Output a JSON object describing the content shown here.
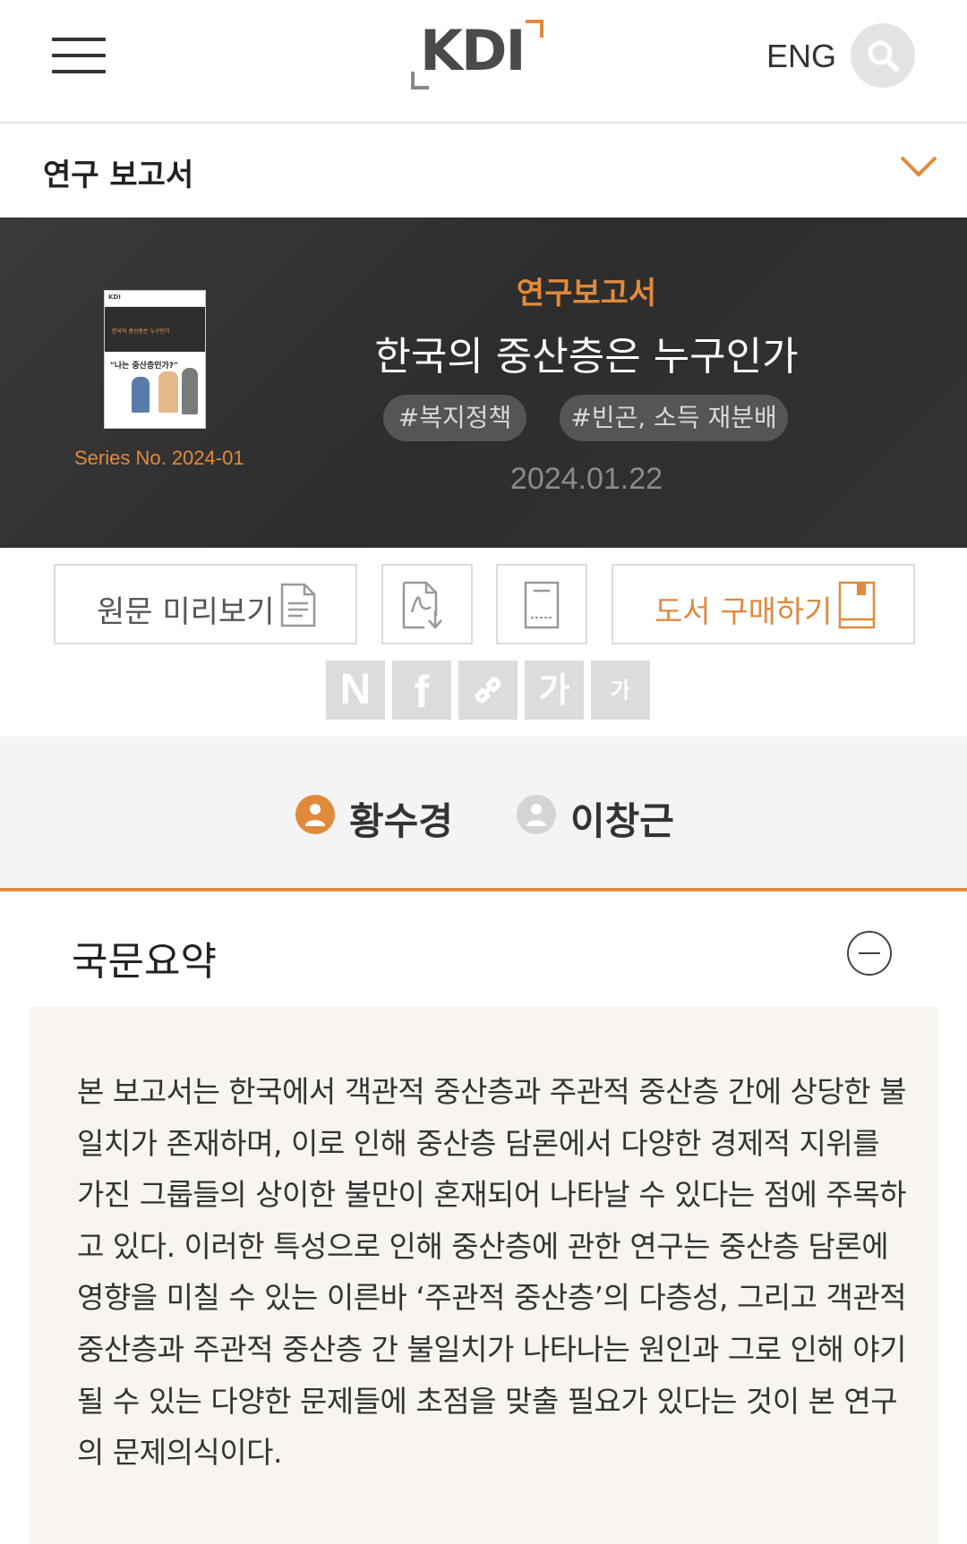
{
  "header": {
    "logo_text": "KDI",
    "lang_label": "ENG",
    "search_icon": "search-icon",
    "menu_icon": "hamburger-icon"
  },
  "category_bar": {
    "title": "연구 보고서",
    "toggle_icon": "chevron-down-icon"
  },
  "banner": {
    "category": "연구보고서",
    "title": "한국의 중산층은 누구인가",
    "tags": [
      "#복지정책",
      "#빈곤, 소득 재분배"
    ],
    "date": "2024.01.22",
    "series": "Series No. 2024-01",
    "cover": {
      "logo": "KDI",
      "cover_title": "한국의 중산층은 누구인가",
      "cover_sub": "\"나는 중산층인가?\""
    }
  },
  "actions": {
    "preview_label": "원문 미리보기",
    "buy_label": "도서 구매하기",
    "pdf_icon": "pdf-download-icon",
    "ebook_icon": "ebook-icon",
    "doc_icon": "document-icon",
    "book_icon": "book-icon"
  },
  "share": {
    "naver": "N",
    "facebook": "f",
    "link_icon": "link-icon",
    "font_large": "가",
    "font_small": "가"
  },
  "authors": [
    {
      "name": "황수경",
      "active": true
    },
    {
      "name": "이창근",
      "active": false
    }
  ],
  "summary": {
    "title": "국문요약",
    "text": "본 보고서는 한국에서 객관적 중산층과 주관적 중산층 간에 상당한 불일치가 존재하며, 이로 인해 중산층 담론에서 다양한 경제적 지위를 가진 그룹들의 상이한 불만이 혼재되어 나타날 수 있다는 점에 주목하고 있다. 이러한 특성으로 인해 중산층에 관한 연구는 중산층 담론에 영향을 미칠 수 있는 이른바 ‘주관적 중산층’의 다층성, 그리고 객관적 중산층과 주관적 중산층 간 불일치가 나타나는 원인과 그로 인해 야기될 수 있는 다양한 문제들에 초점을 맞출 필요가 있다는 것이 본 연구의 문제의식이다."
  },
  "colors": {
    "accent": "#e08a3c",
    "banner_bg": "#333333",
    "summary_bg": "#f8f4ef"
  }
}
